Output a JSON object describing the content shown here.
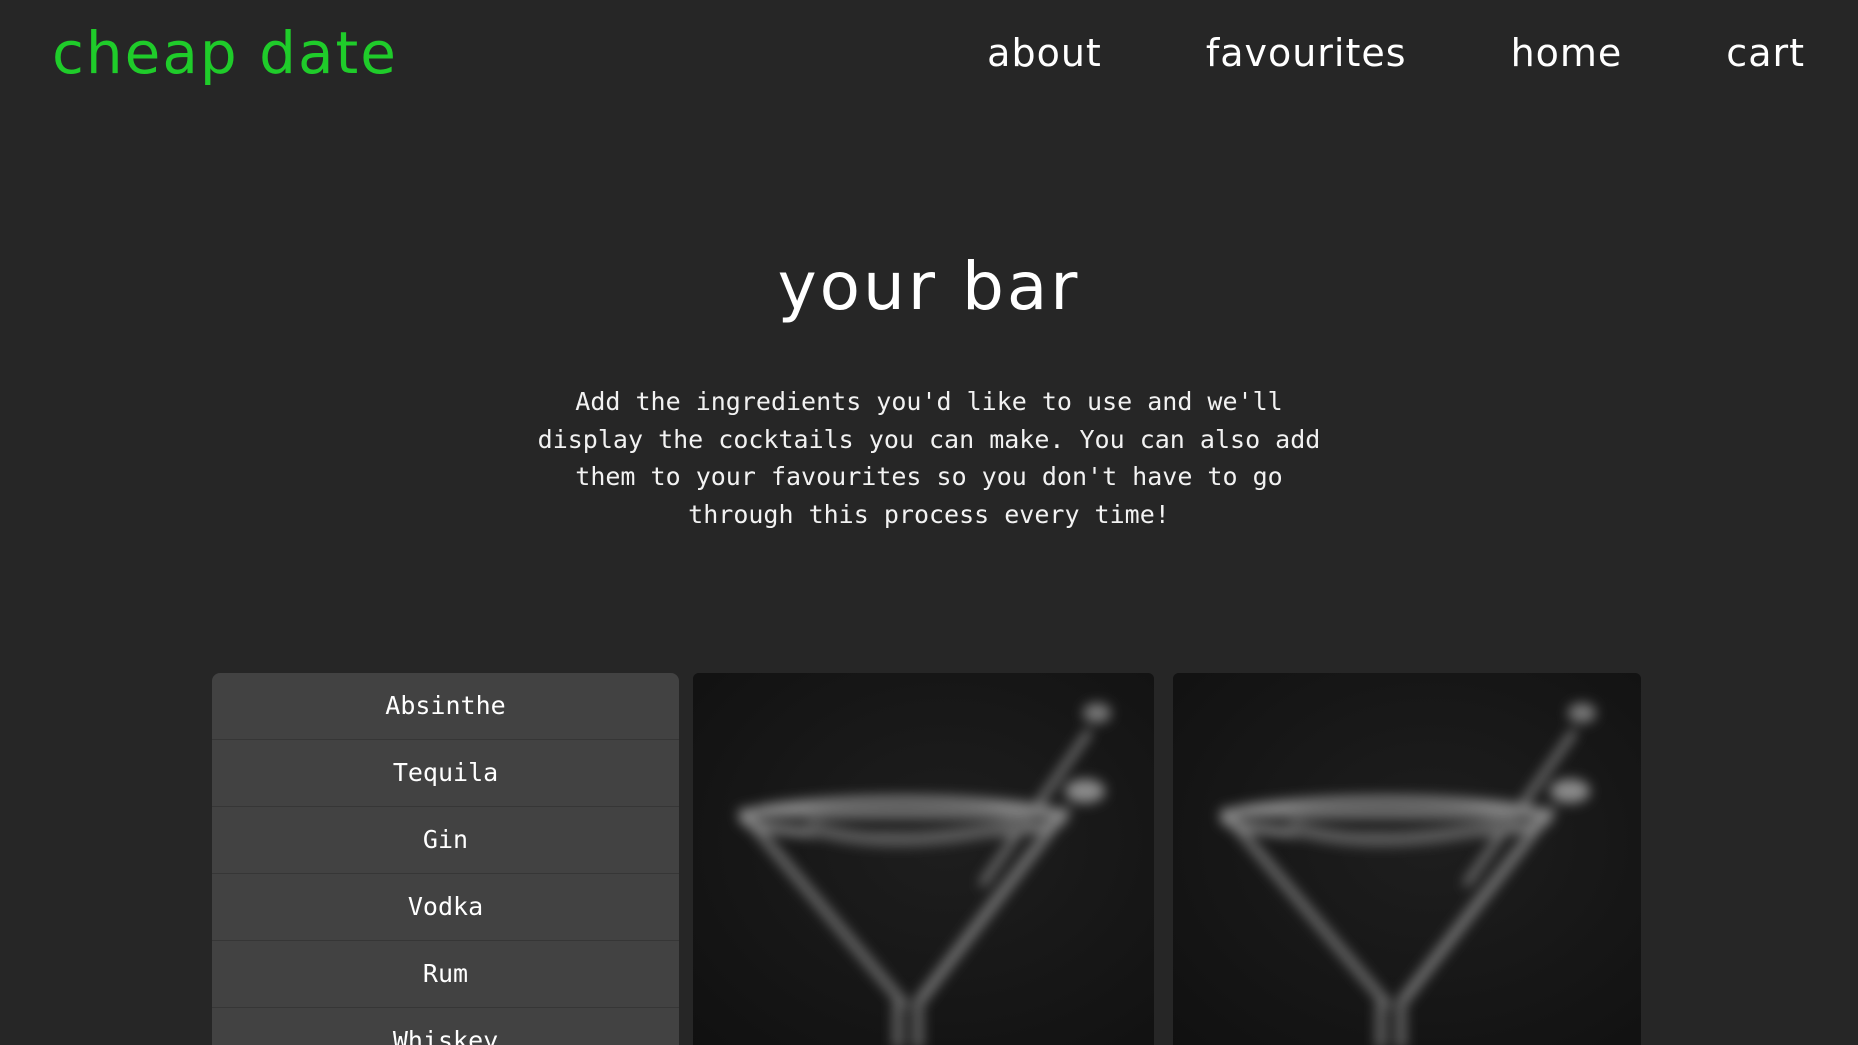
{
  "header": {
    "logo": "cheap date",
    "nav": [
      {
        "label": "about"
      },
      {
        "label": "favourites"
      },
      {
        "label": "home"
      },
      {
        "label": "cart"
      }
    ]
  },
  "main": {
    "title": "your bar",
    "intro": "Add the ingredients you'd like to use and we'll display the cocktails you can make. You can also add them to your favourites so you don't have to go through this process every time!",
    "ingredients": [
      "Absinthe",
      "Tequila",
      "Gin",
      "Vodka",
      "Rum",
      "Whiskey"
    ],
    "cards": [
      {
        "image_icon": "martini-glass-icon"
      },
      {
        "image_icon": "martini-glass-icon"
      }
    ]
  },
  "colors": {
    "background": "#262626",
    "brand": "#1fcc2a",
    "panel": "#424242"
  }
}
